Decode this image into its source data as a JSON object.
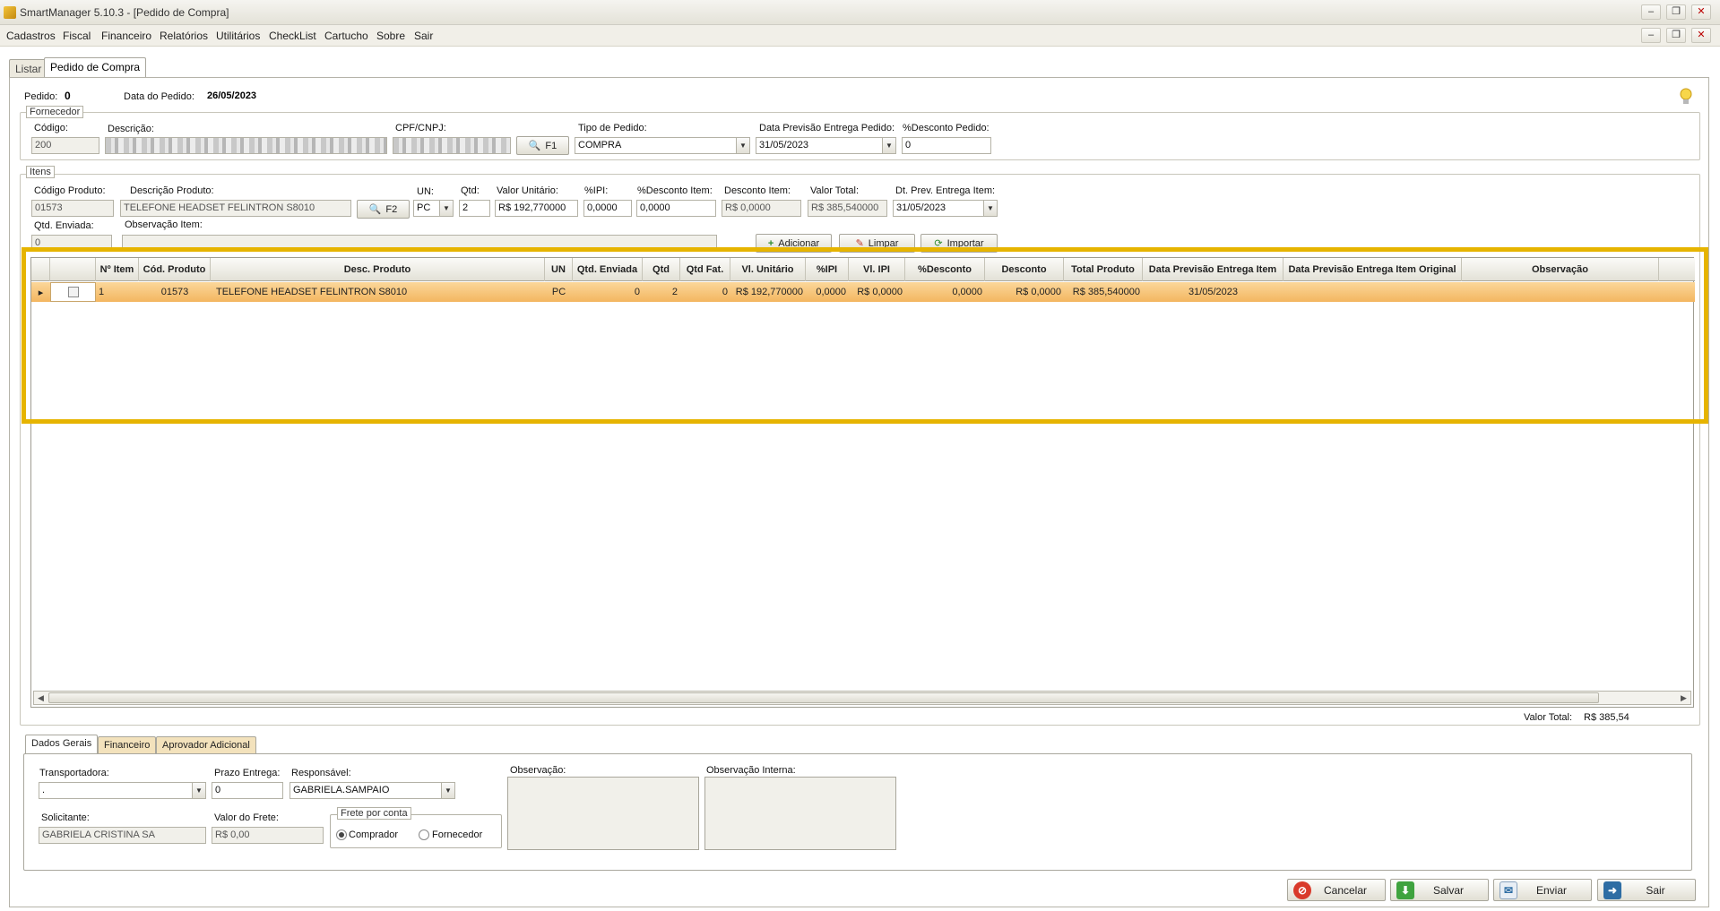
{
  "window": {
    "title": "SmartManager 5.10.3 - [Pedido de Compra]"
  },
  "menu": [
    "Cadastros",
    "Fiscal",
    "Financeiro",
    "Relatórios",
    "Utilitários",
    "CheckList",
    "Cartucho",
    "Sobre",
    "Sair"
  ],
  "tabs": [
    "Listar",
    "Pedido de Compra"
  ],
  "header": {
    "pedido_label": "Pedido:",
    "pedido_value": "0",
    "data_label": "Data do Pedido:",
    "data_value": "26/05/2023"
  },
  "fornecedor": {
    "group_title": "Fornecedor",
    "codigo_label": "Código:",
    "codigo_value": "200",
    "descricao_label": "Descrição:",
    "cpf_label": "CPF/CNPJ:",
    "f1_label": "F1",
    "tipo_label": "Tipo de Pedido:",
    "tipo_value": "COMPRA",
    "previsao_label": "Data Previsão Entrega Pedido:",
    "previsao_value": "31/05/2023",
    "desconto_label": "%Desconto Pedido:",
    "desconto_value": "0"
  },
  "itens": {
    "group_title": "Itens",
    "codigo_label": "Código Produto:",
    "codigo_value": "01573",
    "descricao_label": "Descrição Produto:",
    "descricao_value": "TELEFONE HEADSET FELINTRON S8010",
    "f2_label": "F2",
    "un_label": "UN:",
    "un_value": "PC",
    "qtd_label": "Qtd:",
    "qtd_value": "2",
    "valor_label": "Valor Unitário:",
    "valor_value": "R$ 192,770000",
    "ipi_label": "%IPI:",
    "ipi_value": "0,0000",
    "pdesc_label": "%Desconto Item:",
    "pdesc_value": "0,0000",
    "desc_label": "Desconto Item:",
    "desc_value": "R$ 0,0000",
    "total_label": "Valor Total:",
    "total_value": "R$ 385,540000",
    "dtprev_label": "Dt. Prev. Entrega Item:",
    "dtprev_value": "31/05/2023",
    "qtdenv_label": "Qtd. Enviada:",
    "qtdenv_value": "0",
    "obs_label": "Observação Item:",
    "adicionar": "Adicionar",
    "limpar": "Limpar",
    "importar": "Importar"
  },
  "grid": {
    "columns": [
      "Nº Item",
      "Cód. Produto",
      "Desc. Produto",
      "UN",
      "Qtd. Enviada",
      "Qtd",
      "Qtd Fat.",
      "Vl. Unitário",
      "%IPI",
      "Vl. IPI",
      "%Desconto",
      "Desconto",
      "Total Produto",
      "Data Previsão Entrega Item",
      "Data Previsão Entrega Item Original",
      "Observação"
    ],
    "rows": [
      {
        "item": "1",
        "codigo": "01573",
        "descricao": "TELEFONE HEADSET FELINTRON S8010",
        "un": "PC",
        "qtd_enviada": "0",
        "qtd": "2",
        "qtd_fat": "0",
        "vl_unitario": "R$ 192,770000",
        "ipi": "0,0000",
        "vl_ipi": "R$ 0,0000",
        "pdesconto": "0,0000",
        "desconto": "R$ 0,0000",
        "total": "R$ 385,540000",
        "data_prev": "31/05/2023",
        "data_prev_orig": "",
        "obs": ""
      }
    ]
  },
  "valor_total": {
    "label": "Valor Total:",
    "value": "R$ 385,54"
  },
  "bottom_tabs": [
    "Dados Gerais",
    "Financeiro",
    "Aprovador Adicional"
  ],
  "dados_gerais": {
    "transportadora_label": "Transportadora:",
    "transportadora_value": ".",
    "prazo_label": "Prazo Entrega:",
    "prazo_value": "0",
    "responsavel_label": "Responsável:",
    "responsavel_value": "GABRIELA.SAMPAIO",
    "solicitante_label": "Solicitante:",
    "solicitante_value": "GABRIELA CRISTINA SA",
    "frete_label": "Valor do Frete:",
    "frete_value": "R$ 0,00",
    "frete_group": "Frete por conta",
    "comprador": "Comprador",
    "fornecedor": "Fornecedor",
    "observacao_label": "Observação:",
    "obs_interna_label": "Observação Interna:"
  },
  "actions": {
    "cancelar": "Cancelar",
    "salvar": "Salvar",
    "enviar": "Enviar",
    "sair": "Sair"
  },
  "colors": {
    "selected_row": "#f3b660",
    "highlight_border": "#e6b400"
  }
}
